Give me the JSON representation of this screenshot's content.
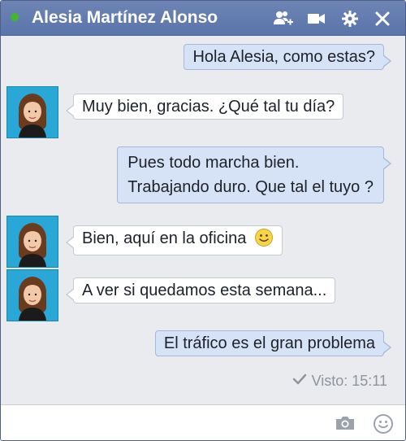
{
  "header": {
    "title": "Alesia Martínez Alonso",
    "status": "online",
    "icons": [
      "online-dot-icon",
      "add-friend-icon",
      "video-call-icon",
      "gear-icon",
      "close-icon"
    ]
  },
  "messages": [
    {
      "side": "out",
      "text": "Hola Alesia, como estas?"
    },
    {
      "side": "in",
      "text": "Muy bien, gracias. ¿Qué tal tu día?",
      "avatar": true
    },
    {
      "side": "out",
      "lines": [
        "Pues todo marcha bien.",
        "Trabajando duro. Que tal el tuyo ?"
      ]
    },
    {
      "side": "in",
      "text": "Bien, aquí en la oficina",
      "emoji": "smile-emoji-icon",
      "avatar": true
    },
    {
      "side": "in",
      "text": "A ver si quedamos esta semana...",
      "avatar": true
    },
    {
      "side": "out",
      "text": "El tráfico es el gran problema"
    }
  ],
  "seen": {
    "label": "Visto: 15:11"
  },
  "composer": {
    "placeholder": "",
    "icons": [
      "camera-icon",
      "emoji-icon"
    ]
  },
  "colors": {
    "titlebar": "#6d84b4",
    "online": "#42b72a",
    "outgoing_bubble": "#d6e3f7",
    "incoming_bubble": "#ffffff",
    "chat_bg": "#e9ebee",
    "avatar_bg": "#29a8d8"
  }
}
